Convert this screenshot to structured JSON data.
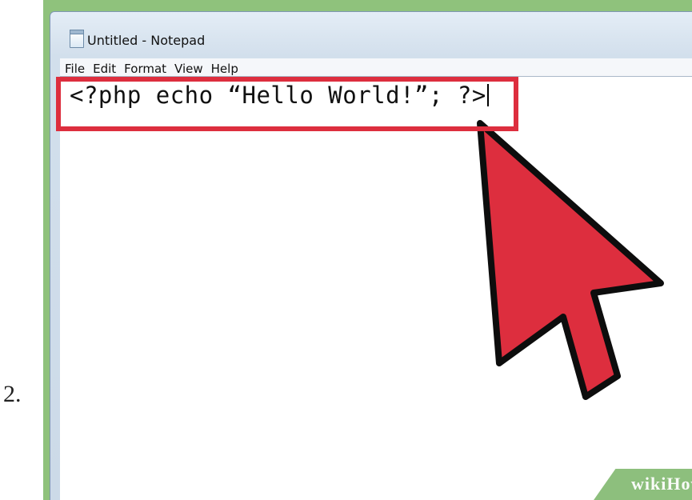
{
  "step_number": "2.",
  "window": {
    "title": "Untitled - Notepad",
    "icon": "notepad-icon"
  },
  "menu": [
    {
      "label": "File"
    },
    {
      "label": "Edit"
    },
    {
      "label": "Format"
    },
    {
      "label": "View"
    },
    {
      "label": "Help"
    }
  ],
  "editor": {
    "content": "<?php echo “Hello World!”; ?>"
  },
  "annotation": {
    "highlight_color": "#dd2e3e",
    "pointer": "arrow-pointer-icon"
  },
  "watermark": {
    "brand": "wikiHow"
  },
  "colors": {
    "background_green": "#8fc27c",
    "annotation_red": "#dd2e3e"
  }
}
